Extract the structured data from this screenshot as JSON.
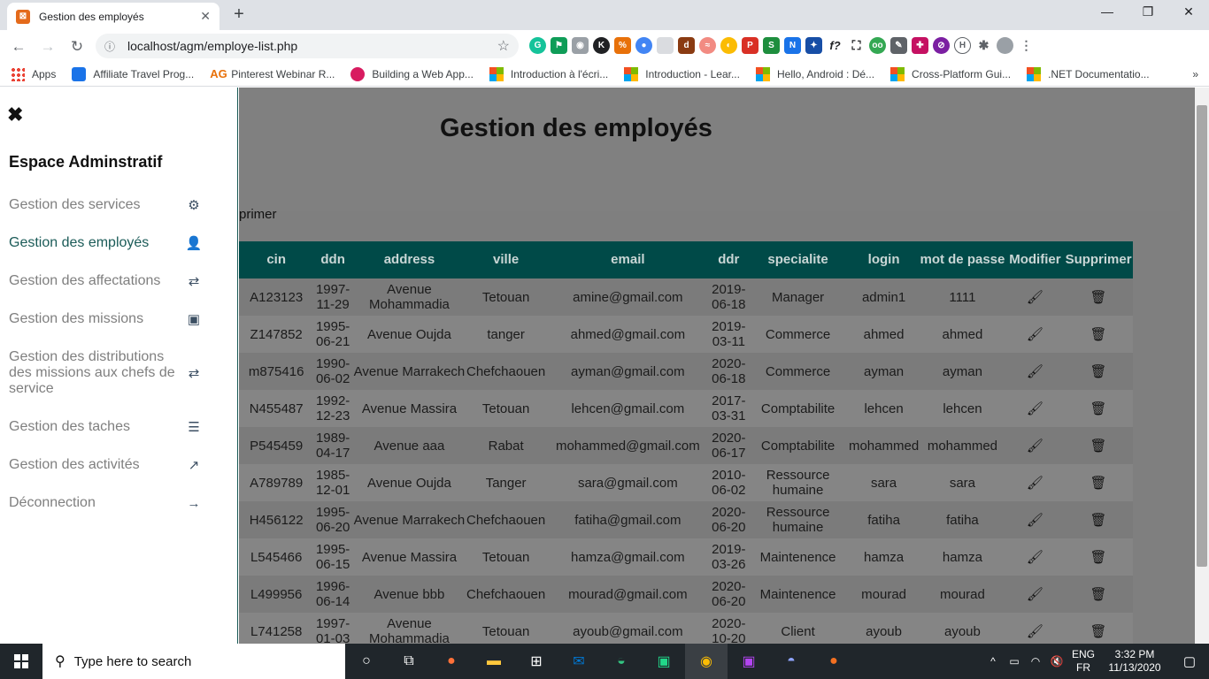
{
  "browser": {
    "tab_title": "Gestion des employés",
    "url": "localhost/agm/employe-list.php",
    "bookmarks": [
      {
        "label": "Apps"
      },
      {
        "label": "Affiliate Travel Prog..."
      },
      {
        "label": "Pinterest Webinar R..."
      },
      {
        "label": "Building a Web App..."
      },
      {
        "label": "Introduction à l'écri..."
      },
      {
        "label": "Introduction - Lear..."
      },
      {
        "label": "Hello, Android : Dé..."
      },
      {
        "label": "Cross-Platform Gui..."
      },
      {
        "label": ".NET Documentatio..."
      }
    ]
  },
  "page": {
    "title": "Gestion des employés",
    "partial_text": "primer"
  },
  "sidebar": {
    "title": "Espace Adminstratif",
    "items": [
      {
        "label": "Gestion des services",
        "icon": "gears-icon"
      },
      {
        "label": "Gestion des employés",
        "icon": "user-tie-icon",
        "active": true
      },
      {
        "label": "Gestion des affectations",
        "icon": "shuffle-icon"
      },
      {
        "label": "Gestion des missions",
        "icon": "briefcase-icon"
      },
      {
        "label": "Gestion des distributions des missions aux chefs de service",
        "icon": "shuffle-icon"
      },
      {
        "label": "Gestion des taches",
        "icon": "tasks-icon"
      },
      {
        "label": "Gestion des activités",
        "icon": "chart-line-icon"
      },
      {
        "label": "Déconnection",
        "icon": "arrow-right-icon"
      }
    ]
  },
  "table": {
    "headers": [
      "cin",
      "ddn",
      "address",
      "ville",
      "email",
      "ddr",
      "specialite",
      "login",
      "mot de passe",
      "Modifier",
      "Supprimer"
    ],
    "rows": [
      [
        "A123123",
        "1997-11-29",
        "Avenue Mohammadia",
        "Tetouan",
        "amine@gmail.com",
        "2019-06-18",
        "Manager",
        "admin1",
        "1111"
      ],
      [
        "Z147852",
        "1995-06-21",
        "Avenue Oujda",
        "tanger",
        "ahmed@gmail.com",
        "2019-03-11",
        "Commerce",
        "ahmed",
        "ahmed"
      ],
      [
        "m875416",
        "1990-06-02",
        "Avenue Marrakech",
        "Chefchaouen",
        "ayman@gmail.com",
        "2020-06-18",
        "Commerce",
        "ayman",
        "ayman"
      ],
      [
        "N455487",
        "1992-12-23",
        "Avenue Massira",
        "Tetouan",
        "lehcen@gmail.com",
        "2017-03-31",
        "Comptabilite",
        "lehcen",
        "lehcen"
      ],
      [
        "P545459",
        "1989-04-17",
        "Avenue aaa",
        "Rabat",
        "mohammed@gmail.com",
        "2020-06-17",
        "Comptabilite",
        "mohammed",
        "mohammed"
      ],
      [
        "A789789",
        "1985-12-01",
        "Avenue Oujda",
        "Tanger",
        "sara@gmail.com",
        "2010-06-02",
        "Ressource humaine",
        "sara",
        "sara"
      ],
      [
        "H456122",
        "1995-06-20",
        "Avenue Marrakech",
        "Chefchaouen",
        "fatiha@gmail.com",
        "2020-06-20",
        "Ressource humaine",
        "fatiha",
        "fatiha"
      ],
      [
        "L545466",
        "1995-06-15",
        "Avenue Massira",
        "Tetouan",
        "hamza@gmail.com",
        "2019-03-26",
        "Maintenence",
        "hamza",
        "hamza"
      ],
      [
        "L499956",
        "1996-06-14",
        "Avenue bbb",
        "Chefchaouen",
        "mourad@gmail.com",
        "2020-06-20",
        "Maintenence",
        "mourad",
        "mourad"
      ],
      [
        "L741258",
        "1997-01-03",
        "Avenue Mohammadia",
        "Tetouan",
        "ayoub@gmail.com",
        "2020-10-20",
        "Client",
        "ayoub",
        "ayoub"
      ]
    ]
  },
  "taskbar": {
    "search_placeholder": "Type here to search",
    "lang_top": "ENG",
    "lang_bottom": "FR",
    "time": "3:32 PM",
    "date": "11/13/2020"
  },
  "colors": {
    "accent": "#004a48",
    "sidebar_active": "#1b5b58",
    "overlay": "#7f7f7f"
  }
}
